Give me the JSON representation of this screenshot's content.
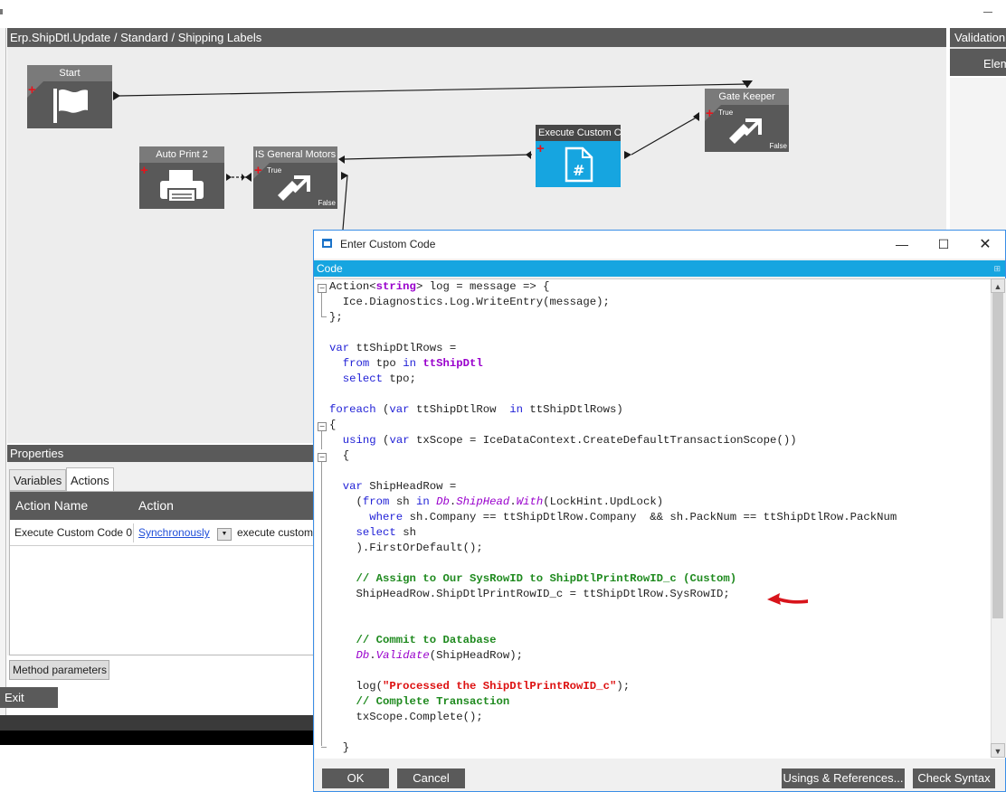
{
  "designer": {
    "title": "Erp.ShipDtl.Update / Standard / Shipping Labels",
    "validation_title": "Validation",
    "validation_tab": "Elem",
    "nodes": {
      "start": "Start",
      "gate_keeper": "Gate Keeper",
      "execute_custom": "Execute Custom Co",
      "is_general_motors": "IS General Motors",
      "auto_print": "Auto Print 2"
    },
    "true_label": "True",
    "false_label": "False"
  },
  "properties": {
    "title": "Properties",
    "tabs": [
      "Variables",
      "Actions"
    ],
    "active_tab": "Actions",
    "columns": [
      "Action Name",
      "Action"
    ],
    "rows": [
      {
        "name": "Execute Custom Code 0",
        "mode": "Synchronously",
        "action": "execute custom"
      }
    ],
    "method_parameters": "Method parameters",
    "exit": "Exit"
  },
  "dialog": {
    "title": "Enter Custom Code",
    "section": "Code",
    "buttons": {
      "ok": "OK",
      "cancel": "Cancel",
      "usings": "Usings & References...",
      "check_syntax": "Check Syntax"
    },
    "code_lines": [
      "Action<string> log = message => {",
      "  Ice.Diagnostics.Log.WriteEntry(message);",
      "};",
      "",
      "var ttShipDtlRows =",
      "  from tpo in ttShipDtl",
      "  select tpo;",
      "",
      "foreach (var ttShipDtlRow  in ttShipDtlRows)",
      "{",
      "  using (var txScope = IceDataContext.CreateDefaultTransactionScope())",
      "  {",
      "",
      "  var ShipHeadRow =",
      "    (from sh in Db.ShipHead.With(LockHint.UpdLock)",
      "      where sh.Company == ttShipDtlRow.Company  && sh.PackNum == ttShipDtlRow.PackNum",
      "    select sh",
      "    ).FirstOrDefault();",
      "",
      "    // Assign to Our SysRowID to ShipDtlPrintRowID_c (Custom)",
      "    ShipHeadRow.ShipDtlPrintRowID_c = ttShipDtlRow.SysRowID;",
      "",
      "",
      "    // Commit to Database",
      "    Db.Validate(ShipHeadRow);",
      "",
      "    log(\"Processed the ShipDtlPrintRowID_c\");",
      "    // Complete Transaction",
      "    txScope.Complete();",
      "",
      "  }"
    ]
  },
  "colors": {
    "accent": "#16a5e0",
    "dark_panel": "#5a5a5a",
    "add_marker": "#e4141b"
  }
}
